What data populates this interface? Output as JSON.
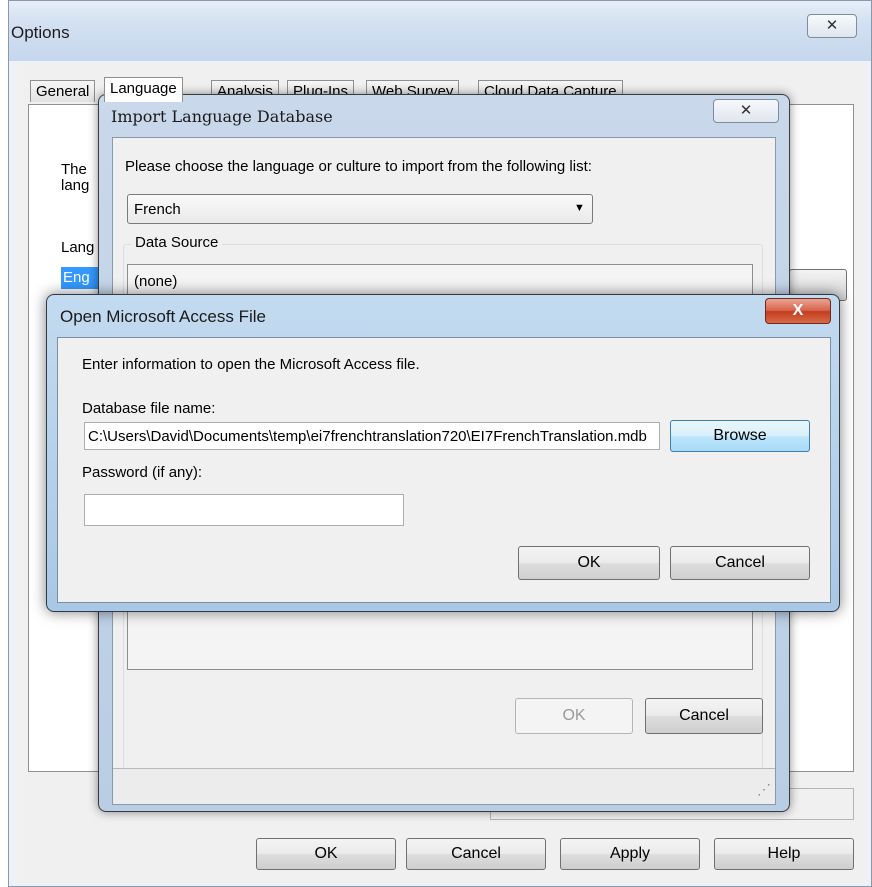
{
  "options": {
    "title": "Options",
    "close_glyph": "✕",
    "tabs": [
      {
        "label": "General"
      },
      {
        "label": "Language"
      },
      {
        "label": "Analysis"
      },
      {
        "label": "Plug-Ins"
      },
      {
        "label": "Web Survey"
      },
      {
        "label": "Cloud Data Capture"
      }
    ],
    "panel": {
      "description_line1": "The",
      "description_line2": "lang",
      "language_label": "Lang",
      "selected_language": "Eng"
    },
    "buttons": {
      "ok": "OK",
      "cancel": "Cancel",
      "apply": "Apply",
      "help": "Help"
    }
  },
  "import_dialog": {
    "title": "Import Language Database",
    "close_glyph": "✕",
    "prompt": "Please choose the language or culture to import from the following list:",
    "language_select": {
      "value": "French",
      "arrow": "▼"
    },
    "data_source": {
      "label": "Data Source",
      "value": "(none)"
    },
    "buttons": {
      "ok": "OK",
      "cancel": "Cancel"
    },
    "grip_glyph": "⋰"
  },
  "access_dialog": {
    "title": "Open Microsoft Access File",
    "close_glyph": "X",
    "instruction": "Enter information to open the Microsoft Access file.",
    "db_file_label": "Database file name:",
    "db_file_value": "C:\\Users\\David\\Documents\\temp\\ei7frenchtranslation720\\EI7FrenchTranslation.mdb",
    "browse_label": "Browse",
    "password_label": "Password (if any):",
    "password_value": "",
    "buttons": {
      "ok": "OK",
      "cancel": "Cancel"
    }
  }
}
